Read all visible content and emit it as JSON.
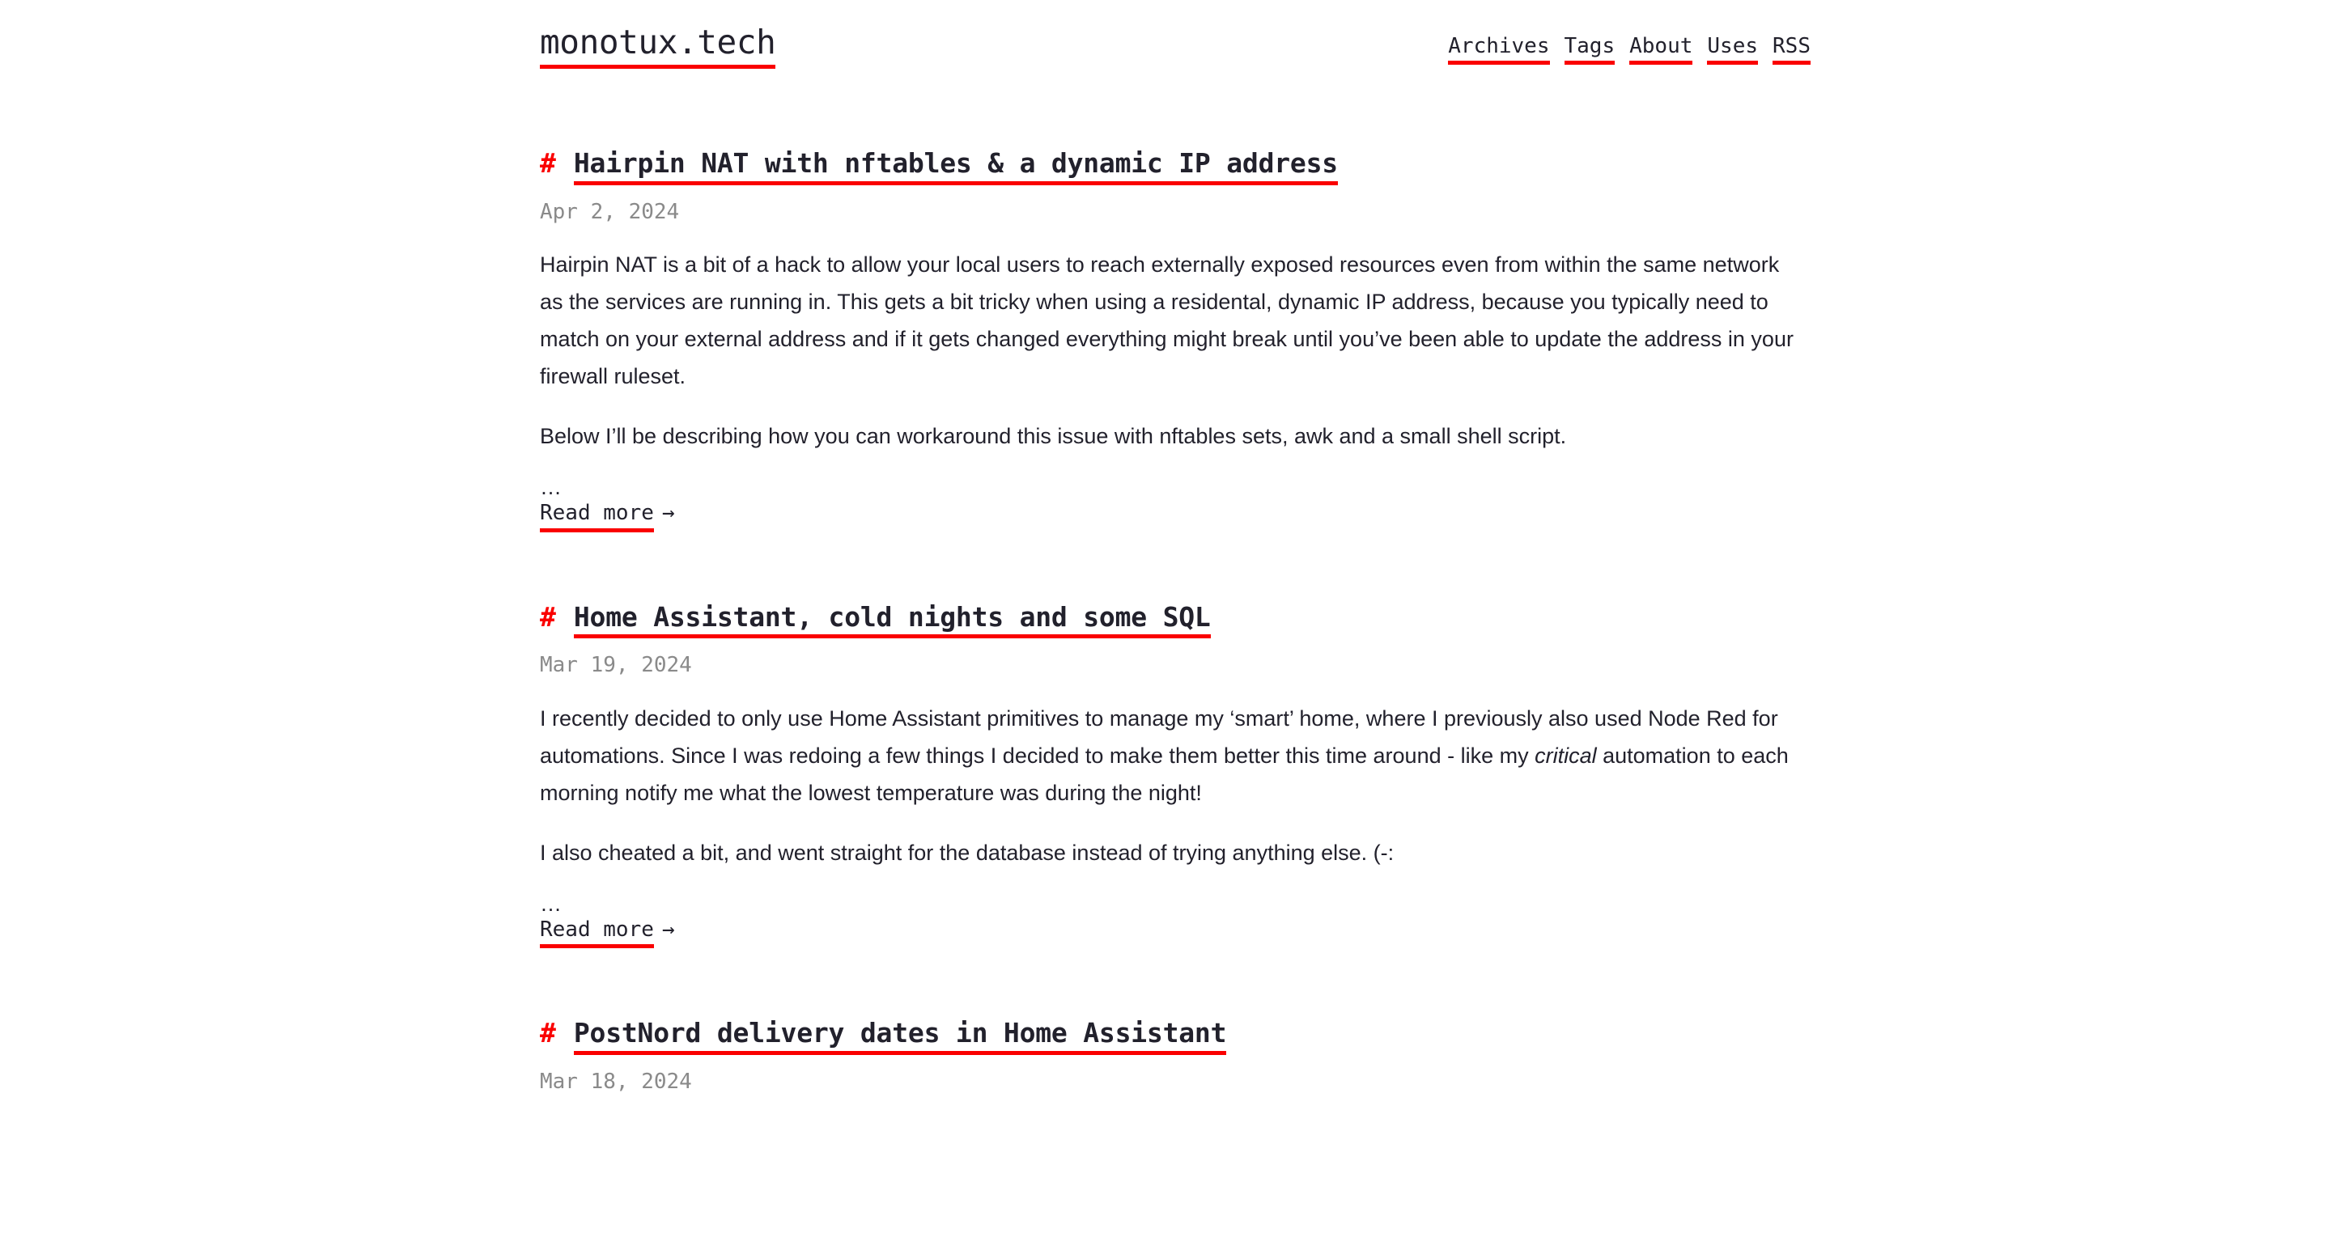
{
  "site": {
    "title": "monotux.tech",
    "accent_color": "#fa0000",
    "text_color": "#22212c",
    "muted_color": "#8a8a8a",
    "background_color": "#ffffff"
  },
  "nav": {
    "items": [
      {
        "label": "Archives"
      },
      {
        "label": "Tags"
      },
      {
        "label": "About"
      },
      {
        "label": "Uses"
      },
      {
        "label": "RSS"
      }
    ]
  },
  "posts": [
    {
      "hash": "#",
      "title": "Hairpin NAT with nftables & a dynamic IP address",
      "date": "Apr 2, 2024",
      "paragraph_1": "Hairpin NAT is a bit of a hack to allow your local users to reach externally exposed resources even from within the same network as the services are running in. This gets a bit tricky when using a residental, dynamic IP address, because you typically need to match on your external address and if it gets changed everything might break until you’ve been able to update the address in your firewall ruleset.",
      "paragraph_2": "Below I’ll be describing how you can workaround this issue with nftables sets, awk and a small shell script.",
      "ellipsis": "…",
      "read_more_text": "Read more",
      "read_more_arrow": "→"
    },
    {
      "hash": "#",
      "title": "Home Assistant, cold nights and some SQL",
      "date": "Mar 19, 2024",
      "paragraph_1_before": "I recently decided to only use Home Assistant primitives to manage my ‘smart’ home, where I previously also used Node Red for automations. Since I was redoing a few things I decided to make them better this time around - like my ",
      "paragraph_1_emphasis": "critical",
      "paragraph_1_after": " automation to each morning notify me what the lowest temperature was during the night!",
      "paragraph_2": "I also cheated a bit, and went straight for the database instead of trying anything else. (-:",
      "ellipsis": "…",
      "read_more_text": "Read more",
      "read_more_arrow": "→"
    },
    {
      "hash": "#",
      "title": "PostNord delivery dates in Home Assistant",
      "date": "Mar 18, 2024"
    }
  ]
}
